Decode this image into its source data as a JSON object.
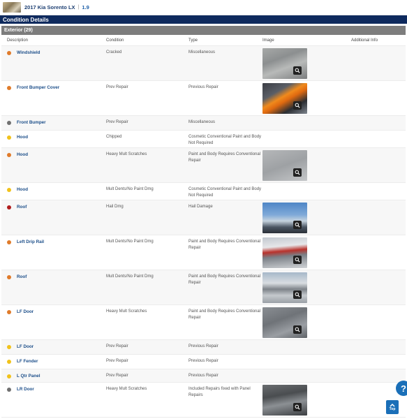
{
  "header": {
    "vehicle_title": "2017 Kia Sorento LX",
    "separator": "|",
    "grade": "1.9"
  },
  "section": {
    "title": "Condition Details"
  },
  "subsection": {
    "title": "Exterior (29)"
  },
  "columns": [
    "Description",
    "Condition",
    "Type",
    "Image",
    "Additional Info"
  ],
  "severity_colors": {
    "orange": "#e07b2a",
    "yellow": "#f1c21b",
    "gray": "#707070",
    "red": "#b01c1c"
  },
  "rows": [
    {
      "dot": "orange",
      "description": "Windshield",
      "condition": "Cracked",
      "type": "Miscellaneous",
      "image": "glass"
    },
    {
      "dot": "orange",
      "description": "Front Bumper Cover",
      "condition": "Prev Repair",
      "type": "Previous Repair",
      "image": "bumper"
    },
    {
      "dot": "gray",
      "description": "Front Bumper",
      "condition": "Prev Repair",
      "type": "Miscellaneous",
      "image": ""
    },
    {
      "dot": "yellow",
      "description": "Hood",
      "condition": "Chipped",
      "type": "Cosmetic Conventional Paint and Body Not Required",
      "image": ""
    },
    {
      "dot": "orange",
      "description": "Hood",
      "condition": "Heavy Mult Scratches",
      "type": "Paint and Body Requires Conventional Repair",
      "image": "gray"
    },
    {
      "dot": "yellow",
      "description": "Hood",
      "condition": "Mult Dents/No Paint Dmg",
      "type": "Cosmetic Conventional Paint and Body Not Required",
      "image": ""
    },
    {
      "dot": "red",
      "description": "Roof",
      "condition": "Hail Dmg",
      "type": "Hail Damage",
      "image": "sky"
    },
    {
      "dot": "orange",
      "description": "Left Drip Rail",
      "condition": "Mult Dents/No Paint Dmg",
      "type": "Paint and Body Requires Conventional Repair",
      "image": "rail"
    },
    {
      "dot": "orange",
      "description": "Roof",
      "condition": "Mult Dents/No Paint Dmg",
      "type": "Paint and Body Requires Conventional Repair",
      "image": "roof"
    },
    {
      "dot": "orange",
      "description": "LF Door",
      "condition": "Heavy Mult Scratches",
      "type": "Paint and Body Requires Conventional Repair",
      "image": "door"
    },
    {
      "dot": "yellow",
      "description": "LF Door",
      "condition": "Prev Repair",
      "type": "Previous Repair",
      "image": ""
    },
    {
      "dot": "yellow",
      "description": "LF Fender",
      "condition": "Prev Repair",
      "type": "Previous Repair",
      "image": ""
    },
    {
      "dot": "yellow",
      "description": "L Qtr Panel",
      "condition": "Prev Repair",
      "type": "Previous Repair",
      "image": ""
    },
    {
      "dot": "gray",
      "description": "LR Door",
      "condition": "Heavy Mult Scratches",
      "type": "Included Repairs fixed with Panel Repairs",
      "image": "dark"
    }
  ],
  "help_button": {
    "label": "?",
    "icon": "help-icon"
  },
  "top_button": {
    "label": "Top",
    "icon": "chevron-up-icon"
  }
}
